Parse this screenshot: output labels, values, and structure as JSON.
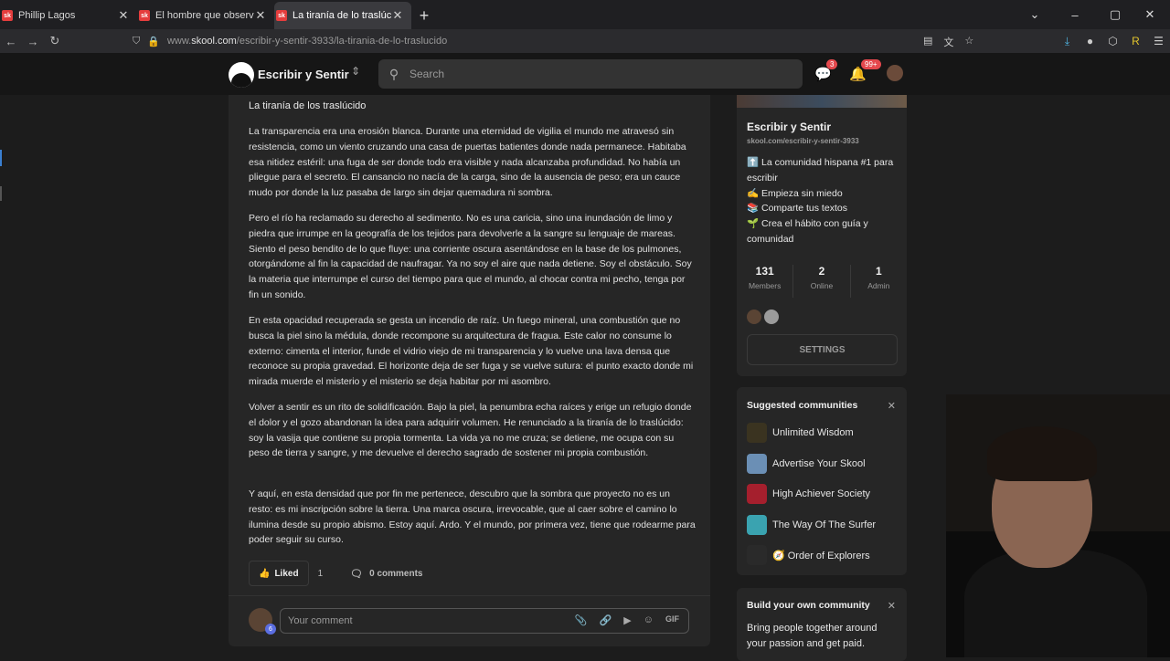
{
  "browser": {
    "tabs": [
      {
        "favicon": "sk",
        "title": "Phillip Lagos",
        "active": false
      },
      {
        "favicon": "sk",
        "title": "El hombre que observó la luz III",
        "active": false
      },
      {
        "favicon": "sk",
        "title": "La tiranía de lo traslúcido - Escri",
        "active": true
      }
    ],
    "url_prefix": "www.",
    "url_host": "skool.com",
    "url_path": "/escribir-y-sentir-3933/la-tirania-de-lo-traslucido"
  },
  "header": {
    "community_name": "Escribir y Sentir",
    "search_placeholder": "Search",
    "chat_badge": "3",
    "notif_badge": "99+"
  },
  "post": {
    "title": "La tiranía de los traslúcido",
    "paragraphs": [
      "La transparencia era una erosión blanca. Durante una eternidad de vigilia el mundo me atravesó sin resistencia, como un viento cruzando una casa de puertas batientes donde nada permanece. Habitaba esa nitidez estéril: una fuga de ser donde todo era visible y nada alcanzaba profundidad. No había un pliegue para el secreto. El cansancio no nacía de la carga, sino de la ausencia de peso; era un cauce mudo por donde la luz pasaba de largo sin dejar quemadura ni sombra.",
      "Pero el río ha reclamado su derecho al sedimento. No es una caricia, sino una inundación de limo y piedra que irrumpe en la geografía de los tejidos para devolverle a la sangre su lenguaje de mareas. Siento el peso bendito de lo que fluye: una corriente oscura asentándose en la base de los pulmones, otorgándome al fin la capacidad de naufragar. Ya no soy el aire que nada detiene. Soy el obstáculo. Soy la materia que interrumpe el curso del tiempo para que el mundo, al chocar contra mi pecho, tenga por fin un sonido.",
      "En esta opacidad recuperada se gesta un incendio de raíz. Un fuego mineral, una combustión que no busca la piel sino la médula, donde recompone su arquitectura de fragua. Este calor no consume lo externo: cimenta el interior, funde el vidrio viejo de mi transparencia y lo vuelve una lava densa que reconoce su propia gravedad. El horizonte deja de ser fuga y se vuelve sutura: el punto exacto donde mi mirada muerde el misterio y el misterio se deja habitar por mi asombro.",
      "Volver a sentir es un rito de solidificación. Bajo la piel, la penumbra echa raíces y erige un refugio donde el dolor y el gozo abandonan la idea para adquirir volumen. He renunciado a la tiranía de lo traslúcido: soy la vasija que contiene su propia tormenta. La vida ya no me cruza; se detiene, me ocupa con su peso de tierra y sangre, y me devuelve el derecho sagrado de sostener mi propia combustión.",
      "Y aquí, en esta densidad que por fin me pertenece, descubro que la sombra que proyecto no es un resto: es mi inscripción sobre la tierra. Una marca oscura, irrevocable, que al caer sobre el camino lo ilumina desde su propio abismo. Estoy aquí. Ardo. Y el mundo, por primera vez, tiene que rodearme para poder seguir su curso."
    ],
    "liked_label": "Liked",
    "like_count": "1",
    "comments_label": "0 comments",
    "comment_placeholder": "Your comment",
    "avatar_level": "6",
    "gif_label": "GIF"
  },
  "about": {
    "name": "Escribir y Sentir",
    "url": "skool.com/escribir-y-sentir-3933",
    "lines": [
      "⬆️ La comunidad hispana #1 para escribir",
      "✍️ Empieza sin miedo",
      "📚 Comparte tus textos",
      "🌱 Crea el hábito con guía y comunidad"
    ],
    "stats": [
      {
        "value": "131",
        "label": "Members"
      },
      {
        "value": "2",
        "label": "Online"
      },
      {
        "value": "1",
        "label": "Admin"
      }
    ],
    "settings_label": "SETTINGS"
  },
  "suggested": {
    "title": "Suggested communities",
    "items": [
      {
        "name": "Unlimited Wisdom",
        "color": "#3a3320"
      },
      {
        "name": "Advertise Your Skool",
        "color": "#6b8fb5"
      },
      {
        "name": "High Achiever Society",
        "color": "#a51f2d"
      },
      {
        "name": "The Way Of The Surfer",
        "color": "#3aa3b0"
      },
      {
        "name": "🧭 Order of Explorers",
        "color": "#2a2a2a"
      }
    ]
  },
  "build": {
    "title": "Build your own community",
    "desc": "Bring people together around your passion and get paid."
  }
}
